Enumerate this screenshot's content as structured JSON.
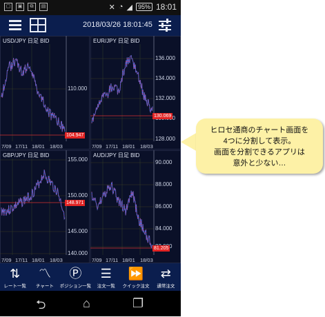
{
  "status_bar": {
    "notifications": [
      "notification-a",
      "notification-b",
      "notification-c",
      "notification-d"
    ],
    "battery": "95%",
    "time": "18:01"
  },
  "top_bar": {
    "datetime": "2018/03/26 18:01:45"
  },
  "charts": [
    {
      "symbol": "USD/JPY",
      "timeframe": "日足",
      "side": "BID",
      "axis_ticks": [
        "110.000"
      ],
      "current_price": "104.947",
      "x_labels": [
        "7/09",
        "17/11",
        "18/01",
        "18/03"
      ],
      "line_color": "#5a6ad6",
      "accent": "#e02a4a"
    },
    {
      "symbol": "EUR/JPY",
      "timeframe": "日足",
      "side": "BID",
      "axis_ticks": [
        "136.000",
        "134.000",
        "132.000",
        "130.000",
        "128.000"
      ],
      "current_price": "130.069",
      "x_labels": [
        "7/09",
        "17/11",
        "18/01",
        "18/03"
      ],
      "line_color": "#5a6ad6",
      "accent": "#e02a4a"
    },
    {
      "symbol": "GBP/JPY",
      "timeframe": "日足",
      "side": "BID",
      "axis_ticks": [
        "155.000",
        "150.000",
        "145.000",
        "140.000"
      ],
      "current_price": "148.971",
      "x_labels": [
        "7/09",
        "17/11",
        "18/01",
        "18/03"
      ],
      "line_color": "#5a6ad6",
      "accent": "#e02a4a"
    },
    {
      "symbol": "AUD/JPY",
      "timeframe": "日足",
      "side": "BID",
      "axis_ticks": [
        "90.000",
        "88.000",
        "86.000",
        "84.000",
        "82.000"
      ],
      "current_price": "81.205",
      "x_labels": [
        "7/09",
        "17/11",
        "18/01",
        "18/03"
      ],
      "line_color": "#5a6ad6",
      "accent": "#e02a4a"
    }
  ],
  "bottom_nav": [
    {
      "icon": "rate-list-icon",
      "label": "レート一覧"
    },
    {
      "icon": "chart-icon",
      "label": "チャート"
    },
    {
      "icon": "position-icon",
      "label": "ポジション一覧"
    },
    {
      "icon": "order-list-icon",
      "label": "注文一覧"
    },
    {
      "icon": "quick-order-icon",
      "label": "クイック注文"
    },
    {
      "icon": "normal-order-icon",
      "label": "通常注文"
    }
  ],
  "android_nav": {
    "back": "back-icon",
    "home": "home-icon",
    "recents": "recents-icon"
  },
  "callout": {
    "lines": [
      "ヒロセ通商のチャート画面を",
      "4つに分割して表示。",
      "画面を分割できるアプリは",
      "意外と少ない…"
    ],
    "background": "#fdf1a6"
  }
}
